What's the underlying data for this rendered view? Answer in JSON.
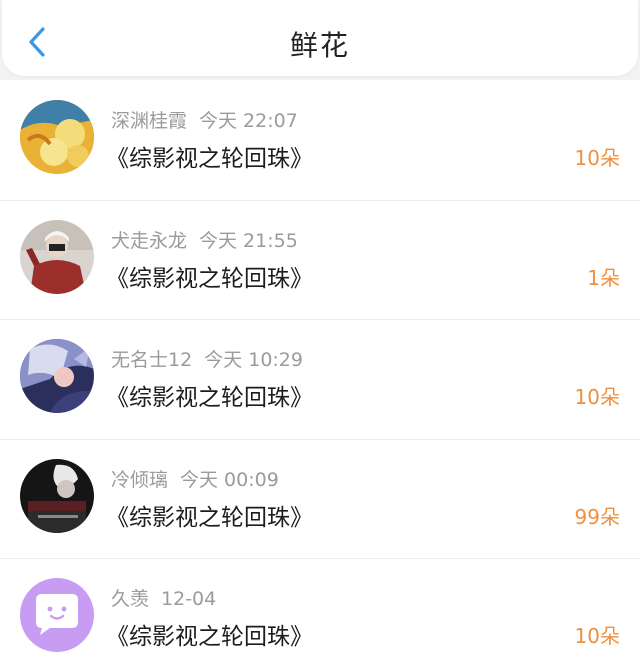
{
  "header": {
    "title": "鲜花",
    "back_icon": "chevron-left-icon",
    "accent_color": "#3a96e6"
  },
  "items": [
    {
      "user": "深渊桂霞",
      "time": "今天 22:07",
      "book": "《综影视之轮回珠》",
      "count": "10朵",
      "avatar": "yellow-fruit-avatar"
    },
    {
      "user": "犬走永龙",
      "time": "今天 21:55",
      "book": "《综影视之轮回珠》",
      "count": "1朵",
      "avatar": "person-red-jacket-avatar"
    },
    {
      "user": "无名士12",
      "time": "今天 10:29",
      "book": "《综影视之轮回珠》",
      "count": "10朵",
      "avatar": "anime-character-avatar"
    },
    {
      "user": "冷倾璃",
      "time": "今天 00:09",
      "book": "《综影视之轮回珠》",
      "count": "99朵",
      "avatar": "dark-photo-avatar"
    },
    {
      "user": "久羡",
      "time": "12-04",
      "book": "《综影视之轮回珠》",
      "count": "10朵",
      "avatar": "default-chat-bubble-avatar"
    }
  ],
  "colors": {
    "count": "#f0903f",
    "meta": "#9b9b9b",
    "text": "#1d1d1d"
  }
}
